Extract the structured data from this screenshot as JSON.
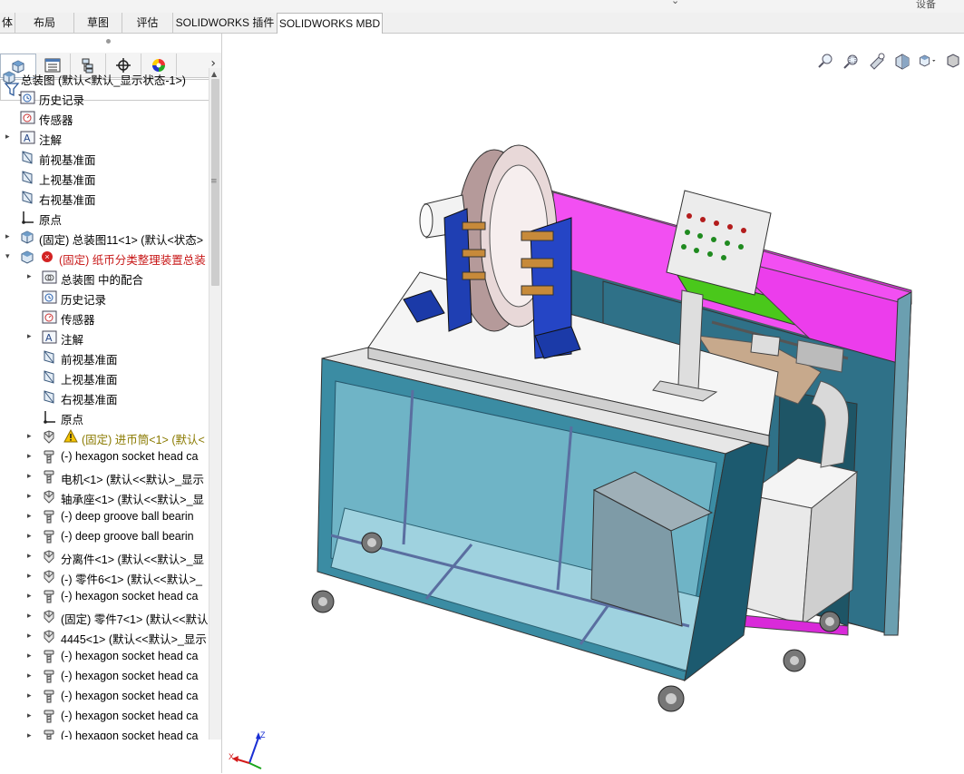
{
  "tabs": [
    {
      "label": "体"
    },
    {
      "label": "布局"
    },
    {
      "label": "草图"
    },
    {
      "label": "评估"
    },
    {
      "label": "SOLIDWORKS 插件"
    },
    {
      "label": "SOLIDWORKS MBD"
    }
  ],
  "topstrip": {
    "right_label": "设备"
  },
  "panel_tabs": [
    "feature-manager",
    "property-manager",
    "configuration-manager",
    "dimxpert-manager",
    "display-manager"
  ],
  "tree": [
    {
      "indent": 0,
      "expander": "",
      "icon": "assembly",
      "text": "总装图  (默认<默认_显示状态-1>)"
    },
    {
      "indent": 1,
      "expander": "",
      "icon": "history",
      "text": "历史记录"
    },
    {
      "indent": 1,
      "expander": "",
      "icon": "sensor",
      "text": "传感器"
    },
    {
      "indent": 1,
      "expander": "▸",
      "icon": "annotation",
      "text": "注解"
    },
    {
      "indent": 1,
      "expander": "",
      "icon": "plane",
      "text": "前视基准面"
    },
    {
      "indent": 1,
      "expander": "",
      "icon": "plane",
      "text": "上视基准面"
    },
    {
      "indent": 1,
      "expander": "",
      "icon": "plane",
      "text": "右视基准面"
    },
    {
      "indent": 1,
      "expander": "",
      "icon": "origin",
      "text": "原点"
    },
    {
      "indent": 1,
      "expander": "▸",
      "icon": "assembly",
      "text": "(固定) 总装图11<1> (默认<状态>"
    },
    {
      "indent": 1,
      "expander": "▾",
      "icon": "assembly-error",
      "text": "(固定) 纸币分类整理装置总装",
      "style": "red"
    },
    {
      "indent": 2,
      "expander": "▸",
      "icon": "mates",
      "text": "总装图 中的配合"
    },
    {
      "indent": 2,
      "expander": "",
      "icon": "history",
      "text": "历史记录"
    },
    {
      "indent": 2,
      "expander": "",
      "icon": "sensor",
      "text": "传感器"
    },
    {
      "indent": 2,
      "expander": "▸",
      "icon": "annotation",
      "text": "注解"
    },
    {
      "indent": 2,
      "expander": "",
      "icon": "plane",
      "text": "前视基准面"
    },
    {
      "indent": 2,
      "expander": "",
      "icon": "plane",
      "text": "上视基准面"
    },
    {
      "indent": 2,
      "expander": "",
      "icon": "plane",
      "text": "右视基准面"
    },
    {
      "indent": 2,
      "expander": "",
      "icon": "origin",
      "text": "原点"
    },
    {
      "indent": 2,
      "expander": "▸",
      "icon": "part-warning",
      "text": "(固定) 进币筒<1> (默认<",
      "style": "olive"
    },
    {
      "indent": 2,
      "expander": "▸",
      "icon": "screw",
      "text": "(-) hexagon socket head ca"
    },
    {
      "indent": 2,
      "expander": "▸",
      "icon": "screw",
      "text": "电机<1> (默认<<默认>_显示"
    },
    {
      "indent": 2,
      "expander": "▸",
      "icon": "part",
      "text": "轴承座<1> (默认<<默认>_显"
    },
    {
      "indent": 2,
      "expander": "▸",
      "icon": "screw",
      "text": "(-) deep groove ball bearin"
    },
    {
      "indent": 2,
      "expander": "▸",
      "icon": "screw",
      "text": "(-) deep groove ball bearin"
    },
    {
      "indent": 2,
      "expander": "▸",
      "icon": "part",
      "text": "分离件<1> (默认<<默认>_显"
    },
    {
      "indent": 2,
      "expander": "▸",
      "icon": "part",
      "text": "(-) 零件6<1> (默认<<默认>_"
    },
    {
      "indent": 2,
      "expander": "▸",
      "icon": "screw",
      "text": "(-) hexagon socket head ca"
    },
    {
      "indent": 2,
      "expander": "▸",
      "icon": "part",
      "text": "(固定) 零件7<1> (默认<<默认"
    },
    {
      "indent": 2,
      "expander": "▸",
      "icon": "part",
      "text": "4445<1> (默认<<默认>_显示"
    },
    {
      "indent": 2,
      "expander": "▸",
      "icon": "screw",
      "text": "(-) hexagon socket head ca"
    },
    {
      "indent": 2,
      "expander": "▸",
      "icon": "screw",
      "text": "(-) hexagon socket head ca"
    },
    {
      "indent": 2,
      "expander": "▸",
      "icon": "screw",
      "text": "(-) hexagon socket head ca"
    },
    {
      "indent": 2,
      "expander": "▸",
      "icon": "screw",
      "text": "(-) hexagon socket head ca"
    },
    {
      "indent": 2,
      "expander": "▸",
      "icon": "screw",
      "text": "(-) hexagon socket head ca"
    }
  ],
  "view_tools": [
    "zoom-to-fit-icon",
    "zoom-to-area-icon",
    "previous-view-icon",
    "section-view-icon",
    "view-orientation-icon",
    "display-style-icon"
  ],
  "triad": {
    "x_label": "X",
    "z_label": "Z"
  },
  "colors": {
    "accent": "#1f5fb8",
    "frame_magenta": "#d21ed2",
    "panel_green": "#44c61a",
    "glass_teal": "#2a6f82"
  }
}
